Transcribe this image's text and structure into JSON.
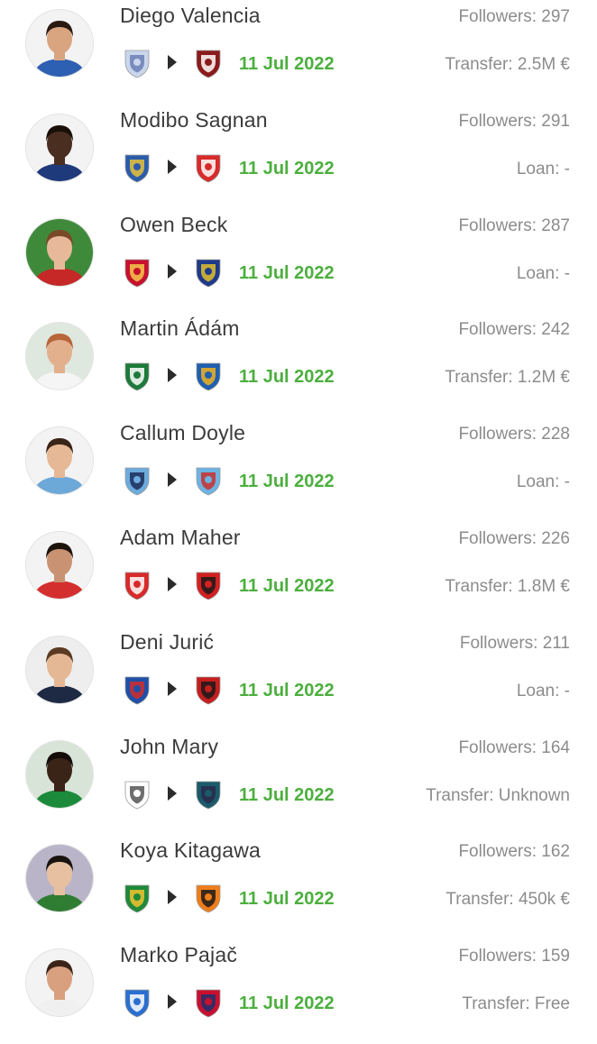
{
  "transfers": [
    {
      "name": "Diego Valencia",
      "followers": "Followers: 297",
      "date": "11 Jul 2022",
      "fee": "Transfer: 2.5M €",
      "from_icon": "universidad-catolica-crest-icon",
      "to_icon": "salernitana-crest-icon",
      "avatar": {
        "skin": "#d9a581",
        "hair": "#2b1a12",
        "shirt": "#2d5fb3",
        "bg": "#f3f3f3"
      },
      "from_colors": {
        "a": "#c9d6ec",
        "b": "#6b7fb5"
      },
      "to_colors": {
        "a": "#8b1a1a",
        "b": "#ffffff"
      }
    },
    {
      "name": "Modibo Sagnan",
      "followers": "Followers: 291",
      "date": "11 Jul 2022",
      "fee": "Loan: -",
      "from_icon": "real-sociedad-crest-icon",
      "to_icon": "fc-utrecht-crest-icon",
      "avatar": {
        "skin": "#4a2e20",
        "hair": "#1a1008",
        "shirt": "#1f3a7a",
        "bg": "#f3f3f3"
      },
      "from_colors": {
        "a": "#2a5caa",
        "b": "#e8c23a"
      },
      "to_colors": {
        "a": "#d92a2a",
        "b": "#ffffff"
      }
    },
    {
      "name": "Owen Beck",
      "followers": "Followers: 287",
      "date": "11 Jul 2022",
      "fee": "Loan: -",
      "from_icon": "liverpool-crest-icon",
      "to_icon": "fc-famalicao-crest-icon",
      "avatar": {
        "skin": "#e8b89a",
        "hair": "#7a4a28",
        "shirt": "#c62828",
        "bg": "#3f8a3a"
      },
      "from_colors": {
        "a": "#c8102e",
        "b": "#f3c84a"
      },
      "to_colors": {
        "a": "#1f3a8a",
        "b": "#e2c02a"
      }
    },
    {
      "name": "Martin Ádám",
      "followers": "Followers: 242",
      "date": "11 Jul 2022",
      "fee": "Transfer: 1.2M €",
      "from_icon": "paksi-fc-crest-icon",
      "to_icon": "ulsan-hyundai-crest-icon",
      "avatar": {
        "skin": "#e3b08e",
        "hair": "#b8653a",
        "shirt": "#f5f5f5",
        "bg": "#dfe8df"
      },
      "from_colors": {
        "a": "#1d7a3a",
        "b": "#ffffff"
      },
      "to_colors": {
        "a": "#1f5fb0",
        "b": "#f0b21e"
      }
    },
    {
      "name": "Callum Doyle",
      "followers": "Followers: 228",
      "date": "11 Jul 2022",
      "fee": "Loan: -",
      "from_icon": "manchester-city-crest-icon",
      "to_icon": "coventry-city-crest-icon",
      "avatar": {
        "skin": "#e6b896",
        "hair": "#3a2418",
        "shirt": "#6ca8d8",
        "bg": "#f3f3f3"
      },
      "from_colors": {
        "a": "#6cabdd",
        "b": "#1c2c5b"
      },
      "to_colors": {
        "a": "#6db3e3",
        "b": "#c9302c"
      }
    },
    {
      "name": "Adam Maher",
      "followers": "Followers: 226",
      "date": "11 Jul 2022",
      "fee": "Transfer: 1.8M €",
      "from_icon": "fc-utrecht-crest-icon",
      "to_icon": "fatih-karagumruk-crest-icon",
      "avatar": {
        "skin": "#c99272",
        "hair": "#1e140e",
        "shirt": "#d32f2f",
        "bg": "#f3f3f3"
      },
      "from_colors": {
        "a": "#d92a2a",
        "b": "#ffffff"
      },
      "to_colors": {
        "a": "#d32020",
        "b": "#1a1a1a"
      }
    },
    {
      "name": "Deni Jurić",
      "followers": "Followers: 211",
      "date": "11 Jul 2022",
      "fee": "Loan: -",
      "from_icon": "dinamo-zagreb-crest-icon",
      "to_icon": "bodrumspor-crest-icon",
      "avatar": {
        "skin": "#e4b894",
        "hair": "#5a3a22",
        "shirt": "#1e2a44",
        "bg": "#eeeeee"
      },
      "from_colors": {
        "a": "#1f4fa8",
        "b": "#d22b2b"
      },
      "to_colors": {
        "a": "#c41e1e",
        "b": "#1a1a1a"
      }
    },
    {
      "name": "John Mary",
      "followers": "Followers: 164",
      "date": "11 Jul 2022",
      "fee": "Transfer: Unknown",
      "from_icon": "alki-oroklini-crest-icon",
      "to_icon": "avispa-fukuoka-crest-icon",
      "avatar": {
        "skin": "#3a2418",
        "hair": "#140c08",
        "shirt": "#1b8a3a",
        "bg": "#d8e4d8"
      },
      "from_colors": {
        "a": "#ffffff",
        "b": "#555555"
      },
      "to_colors": {
        "a": "#1a5a6a",
        "b": "#2a2a4a"
      }
    },
    {
      "name": "Koya Kitagawa",
      "followers": "Followers: 162",
      "date": "11 Jul 2022",
      "fee": "Transfer: 450k €",
      "from_icon": "rapid-wien-crest-icon",
      "to_icon": "shimizu-s-pulse-crest-icon",
      "avatar": {
        "skin": "#e6c0a0",
        "hair": "#1a1410",
        "shirt": "#2e7d32",
        "bg": "#b9b4c8"
      },
      "from_colors": {
        "a": "#1e8a3a",
        "b": "#f2c230"
      },
      "to_colors": {
        "a": "#f07d1a",
        "b": "#1a1a1a"
      }
    },
    {
      "name": "Marko Pajač",
      "followers": "Followers: 159",
      "date": "11 Jul 2022",
      "fee": "Transfer: Free",
      "from_icon": "brescia-crest-icon",
      "to_icon": "genoa-crest-icon",
      "avatar": {
        "skin": "#d8a07e",
        "hair": "#3a2418",
        "shirt": "#f0f0f0",
        "bg": "#f3f3f3"
      },
      "from_colors": {
        "a": "#2a6fd0",
        "b": "#ffffff"
      },
      "to_colors": {
        "a": "#c8102e",
        "b": "#1f2f6e"
      }
    }
  ]
}
